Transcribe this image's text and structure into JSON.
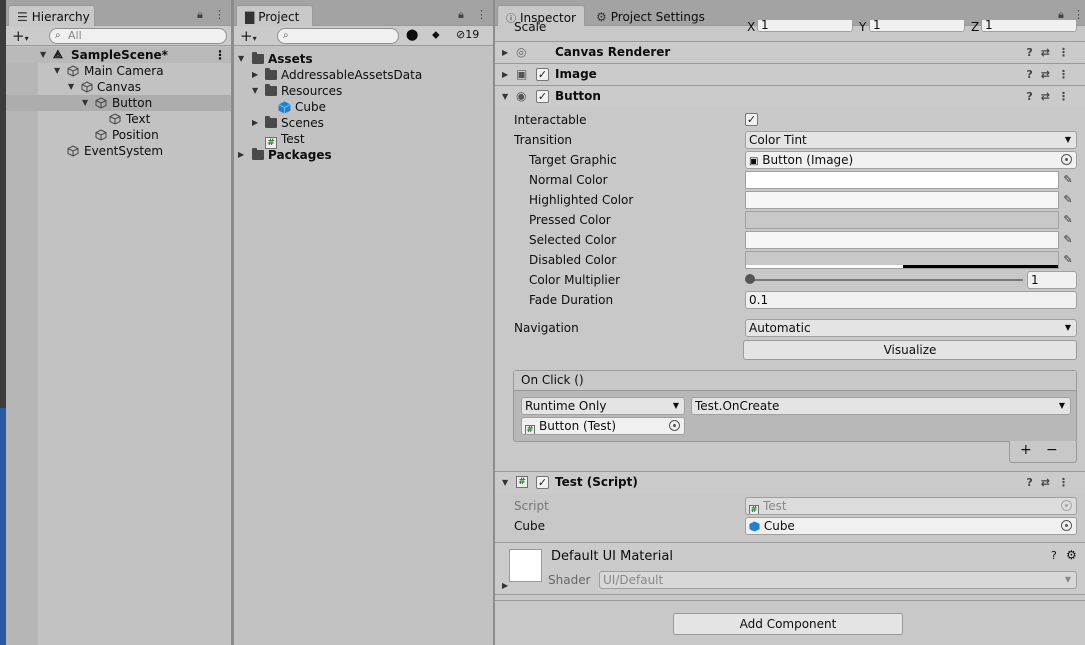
{
  "hierarchy": {
    "tab_label": "Hierarchy",
    "search_placeholder": "All",
    "items": [
      {
        "label": "SampleScene*"
      },
      {
        "label": "Main Camera"
      },
      {
        "label": "Canvas"
      },
      {
        "label": "Button"
      },
      {
        "label": "Text"
      },
      {
        "label": "Position"
      },
      {
        "label": "EventSystem"
      }
    ]
  },
  "project": {
    "tab_label": "Project",
    "hidden_count": "19",
    "items": [
      {
        "label": "Assets"
      },
      {
        "label": "AddressableAssetsData"
      },
      {
        "label": "Resources"
      },
      {
        "label": "Cube"
      },
      {
        "label": "Scenes"
      },
      {
        "label": "Test"
      },
      {
        "label": "Packages"
      }
    ]
  },
  "inspector": {
    "tab_label": "Inspector",
    "settings_tab_label": "Project Settings",
    "scale_label": "Scale",
    "axis_x": "X",
    "axis_y": "Y",
    "axis_z": "Z",
    "scale_values": [
      "1",
      "1",
      "1"
    ],
    "components": {
      "canvas_renderer": "Canvas Renderer",
      "image": "Image",
      "button": "Button",
      "test_script": "Test (Script)"
    },
    "button_fields": {
      "interactable_label": "Interactable",
      "transition_label": "Transition",
      "transition_value": "Color Tint",
      "target_graphic_label": "Target Graphic",
      "target_graphic_value": "Button (Image)",
      "normal_color_label": "Normal Color",
      "highlighted_color_label": "Highlighted Color",
      "pressed_color_label": "Pressed Color",
      "selected_color_label": "Selected Color",
      "disabled_color_label": "Disabled Color",
      "color_multiplier_label": "Color Multiplier",
      "color_multiplier_value": "1",
      "color_multiplier_fraction": 0.0,
      "fade_duration_label": "Fade Duration",
      "fade_duration_value": "0.1",
      "navigation_label": "Navigation",
      "navigation_value": "Automatic",
      "visualize_label": "Visualize"
    },
    "on_click": {
      "header": "On Click ()",
      "mode": "Runtime Only",
      "function": "Test.OnCreate",
      "target": "Button (Test)",
      "add_label": "+",
      "remove_label": "−"
    },
    "test_script_fields": {
      "script_label": "Script",
      "script_value": "Test",
      "cube_label": "Cube",
      "cube_value": "Cube"
    },
    "material": {
      "name": "Default UI Material",
      "shader_label": "Shader",
      "shader_value": "UI/Default"
    },
    "add_component_label": "Add Component"
  },
  "colors": {
    "normal": "#ffffff",
    "highlighted": "#f5f5f5",
    "pressed": "#c8c8c8",
    "selected": "#f5f5f5",
    "disabled": "#c8c8c8",
    "cube_icon": "#1f7fd6"
  }
}
